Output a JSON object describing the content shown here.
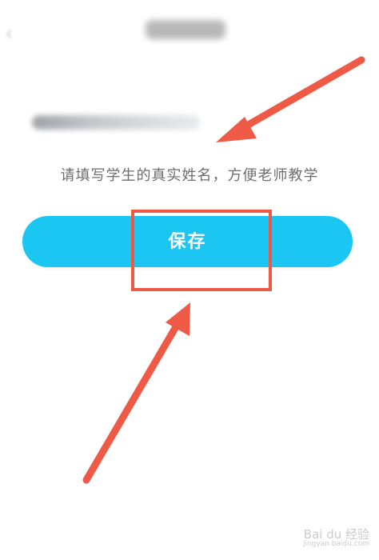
{
  "header": {
    "back_icon": "chevron-left-icon"
  },
  "form": {
    "name_value": "",
    "hint": "请填写学生的真实姓名，方便老师教学",
    "save_label": "保存"
  },
  "annotation": {
    "arrow_color": "#ee5a45",
    "highlight_color": "#ee5a45"
  },
  "theme": {
    "button_color": "#1bc6f2"
  },
  "watermark": {
    "logo": "Bai du 经验",
    "url": "jingyan.baidu.com"
  }
}
